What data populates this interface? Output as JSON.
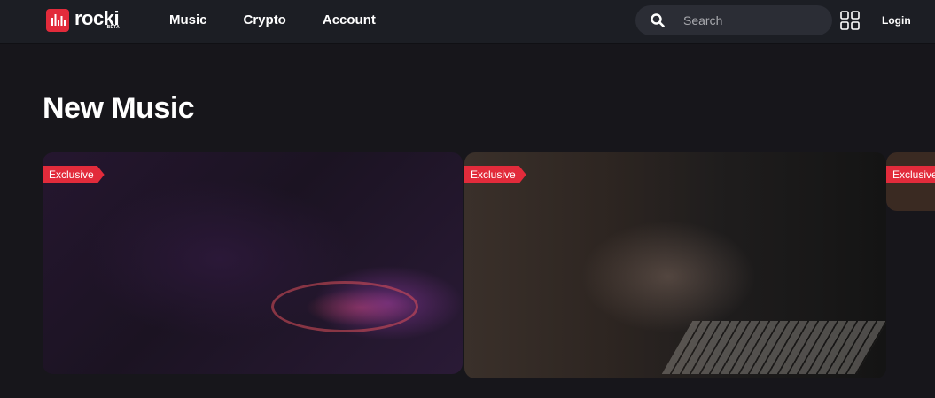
{
  "brand": {
    "name": "rocki",
    "beta": "BETA",
    "accent": "#e22b3b"
  },
  "nav": {
    "items": [
      {
        "label": "Music"
      },
      {
        "label": "Crypto"
      },
      {
        "label": "Account"
      }
    ]
  },
  "search": {
    "placeholder": "Search",
    "value": ""
  },
  "header": {
    "apps_icon": "grid-icon",
    "login_label": "Login"
  },
  "section": {
    "title": "New Music",
    "cards": [
      {
        "badge": "Exclusive",
        "image": "dj-mixer-purple"
      },
      {
        "badge": "Exclusive",
        "image": "piano-hands"
      },
      {
        "badge": "Exclusive",
        "image": "partial-card"
      }
    ]
  }
}
